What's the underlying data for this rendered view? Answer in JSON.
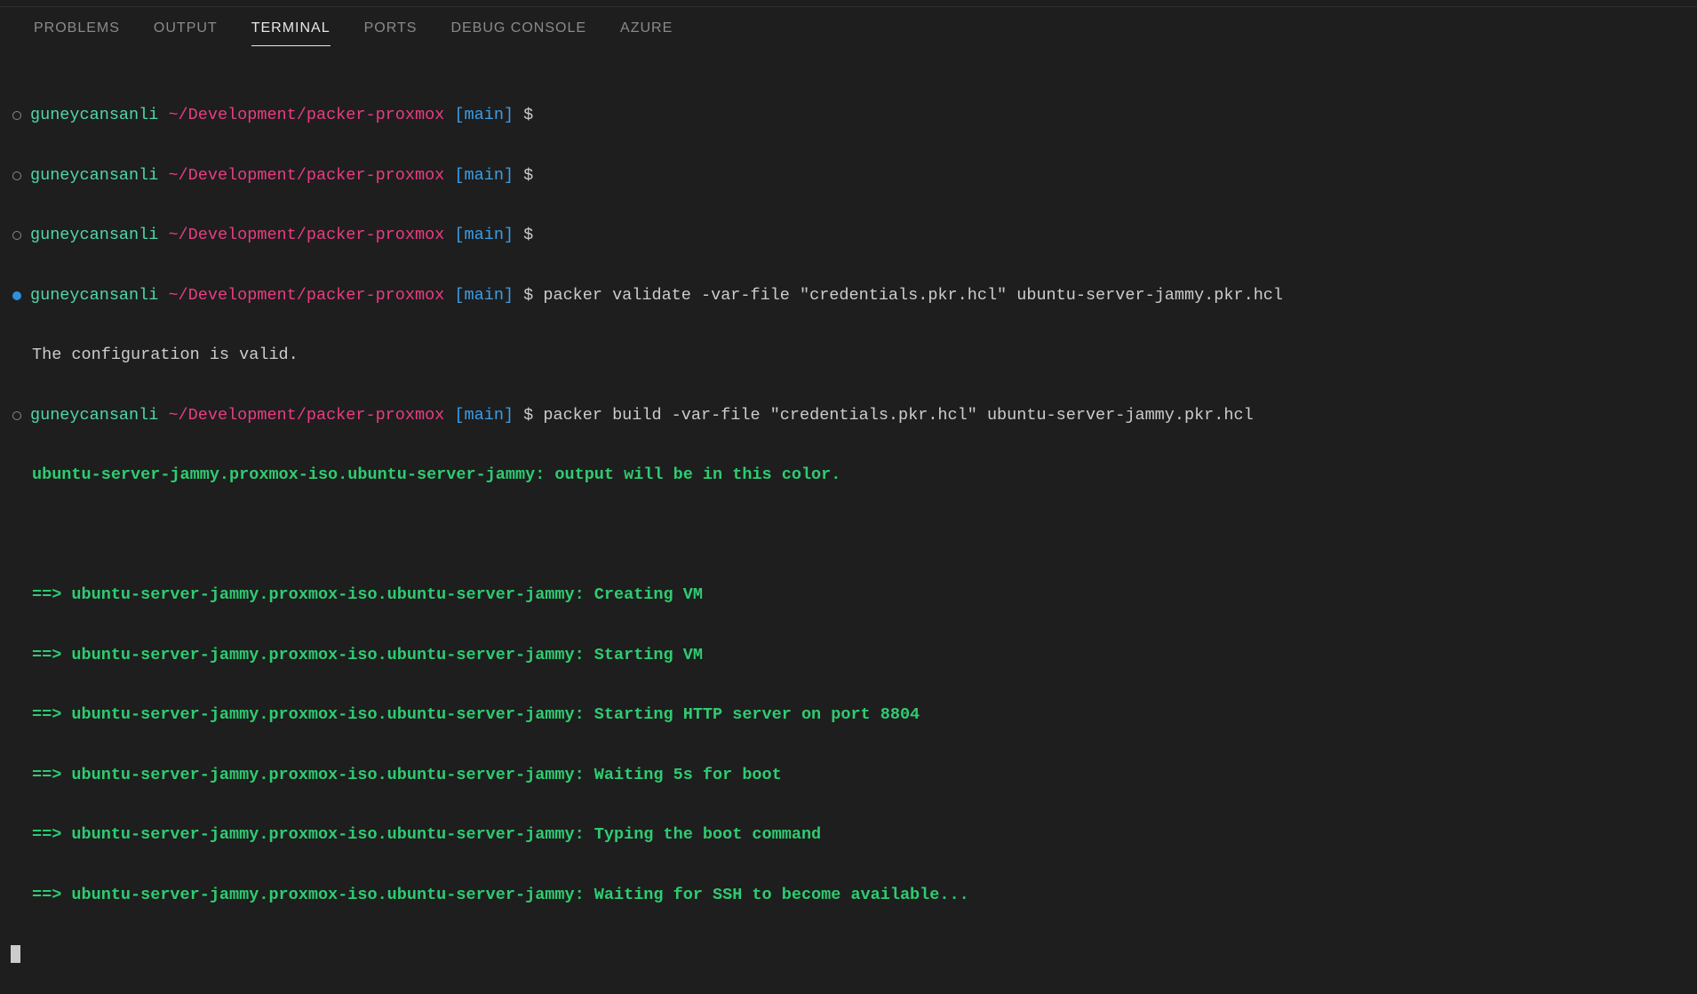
{
  "tabs": {
    "problems": "PROBLEMS",
    "output": "OUTPUT",
    "terminal": "TERMINAL",
    "ports": "PORTS",
    "debug": "DEBUG CONSOLE",
    "azure": "AZURE"
  },
  "prompt": {
    "user": "guneycansanli",
    "path": "~/Development/packer-proxmox",
    "branch": "[main]",
    "dollar": "$"
  },
  "lines": {
    "cmd_validate": "packer validate -var-file \"credentials.pkr.hcl\" ubuntu-server-jammy.pkr.hcl",
    "valid_msg": "The configuration is valid.",
    "cmd_build": "packer build -var-file \"credentials.pkr.hcl\" ubuntu-server-jammy.pkr.hcl",
    "build_header": "ubuntu-server-jammy.proxmox-iso.ubuntu-server-jammy: output will be in this color.",
    "b1": "==> ubuntu-server-jammy.proxmox-iso.ubuntu-server-jammy: Creating VM",
    "b2": "==> ubuntu-server-jammy.proxmox-iso.ubuntu-server-jammy: Starting VM",
    "b3": "==> ubuntu-server-jammy.proxmox-iso.ubuntu-server-jammy: Starting HTTP server on port 8804",
    "b4": "==> ubuntu-server-jammy.proxmox-iso.ubuntu-server-jammy: Waiting 5s for boot",
    "b5": "==> ubuntu-server-jammy.proxmox-iso.ubuntu-server-jammy: Typing the boot command",
    "b6": "==> ubuntu-server-jammy.proxmox-iso.ubuntu-server-jammy: Waiting for SSH to become available..."
  }
}
